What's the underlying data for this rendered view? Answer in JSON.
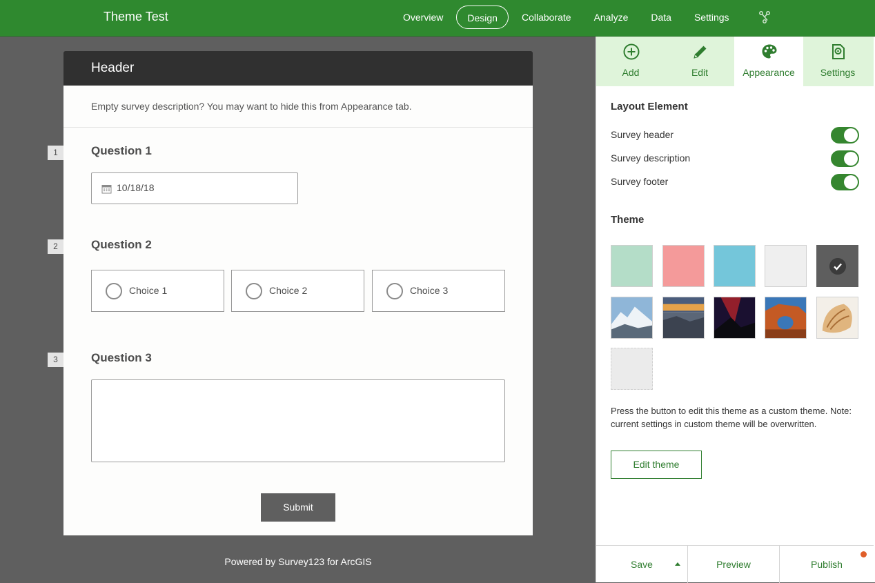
{
  "app": {
    "title": "Theme Test"
  },
  "nav": {
    "items": [
      {
        "label": "Overview",
        "active": false
      },
      {
        "label": "Design",
        "active": true
      },
      {
        "label": "Collaborate",
        "active": false
      },
      {
        "label": "Analyze",
        "active": false
      },
      {
        "label": "Data",
        "active": false
      },
      {
        "label": "Settings",
        "active": false
      }
    ],
    "share_icon": "share-icon"
  },
  "survey": {
    "header": "Header",
    "description": "Empty survey description? You may want to hide this from Appearance tab.",
    "questions": [
      {
        "number": "1",
        "title": "Question 1",
        "type": "date",
        "value": "10/18/18"
      },
      {
        "number": "2",
        "title": "Question 2",
        "type": "single-choice",
        "choices": [
          "Choice 1",
          "Choice 2",
          "Choice 3"
        ]
      },
      {
        "number": "3",
        "title": "Question 3",
        "type": "multiline",
        "value": ""
      }
    ],
    "submit_label": "Submit",
    "footer": "Powered by Survey123 for ArcGIS"
  },
  "panel": {
    "tabs": [
      {
        "label": "Add",
        "icon": "plus-circle-icon",
        "active": false
      },
      {
        "label": "Edit",
        "icon": "pencil-icon",
        "active": false
      },
      {
        "label": "Appearance",
        "icon": "palette-icon",
        "active": true
      },
      {
        "label": "Settings",
        "icon": "settings-document-icon",
        "active": false
      }
    ],
    "layout_title": "Layout Element",
    "toggles": [
      {
        "label": "Survey header",
        "on": true
      },
      {
        "label": "Survey description",
        "on": true
      },
      {
        "label": "Survey footer",
        "on": true
      }
    ],
    "theme_title": "Theme",
    "themes": [
      {
        "name": "mint",
        "color": "#b4ddc8",
        "selected": false
      },
      {
        "name": "coral",
        "color": "#f49a9a",
        "selected": false
      },
      {
        "name": "sky",
        "color": "#74c6da",
        "selected": false
      },
      {
        "name": "light-gray",
        "color": "#efefef",
        "selected": false
      },
      {
        "name": "dark-gray",
        "color": "#5e5e5e",
        "selected": true
      },
      {
        "name": "snow-mountain",
        "image": "mountain-photo",
        "selected": false
      },
      {
        "name": "rocky-shore",
        "image": "shore-sunset-photo",
        "selected": false
      },
      {
        "name": "night-sky",
        "image": "night-sky-photo",
        "selected": false
      },
      {
        "name": "desert-arch",
        "image": "arch-photo",
        "selected": false
      },
      {
        "name": "seashell",
        "image": "shell-photo",
        "selected": false
      },
      {
        "name": "custom",
        "color": "#ebebeb",
        "selected": false
      }
    ],
    "note": "Press the button to edit this theme as a custom theme. Note: current settings in custom theme will be overwritten.",
    "edit_theme_label": "Edit theme",
    "bottom": {
      "save": "Save",
      "preview": "Preview",
      "publish": "Publish"
    }
  },
  "colors": {
    "brand_green": "#2f892f",
    "accent_green": "#2f7d2f",
    "tab_bg": "#dff4da",
    "notify": "#e05f2a"
  }
}
